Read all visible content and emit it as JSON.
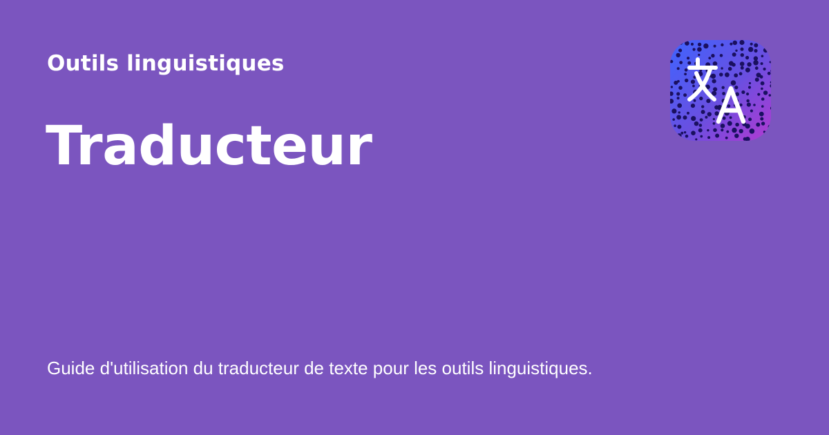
{
  "colors": {
    "background": "#7b55bf",
    "text": "#ffffff",
    "icon_gradient_start": "#3f64ff",
    "icon_gradient_mid": "#6a4fe0",
    "icon_gradient_end": "#b23ad1",
    "icon_dots": "#1a1060"
  },
  "header": {
    "category": "Outils linguistiques",
    "title": "Traducteur"
  },
  "main": {
    "description": "Guide d'utilisation du traducteur de texte pour les outils linguistiques."
  },
  "app_icon": {
    "name": "translate-icon"
  }
}
